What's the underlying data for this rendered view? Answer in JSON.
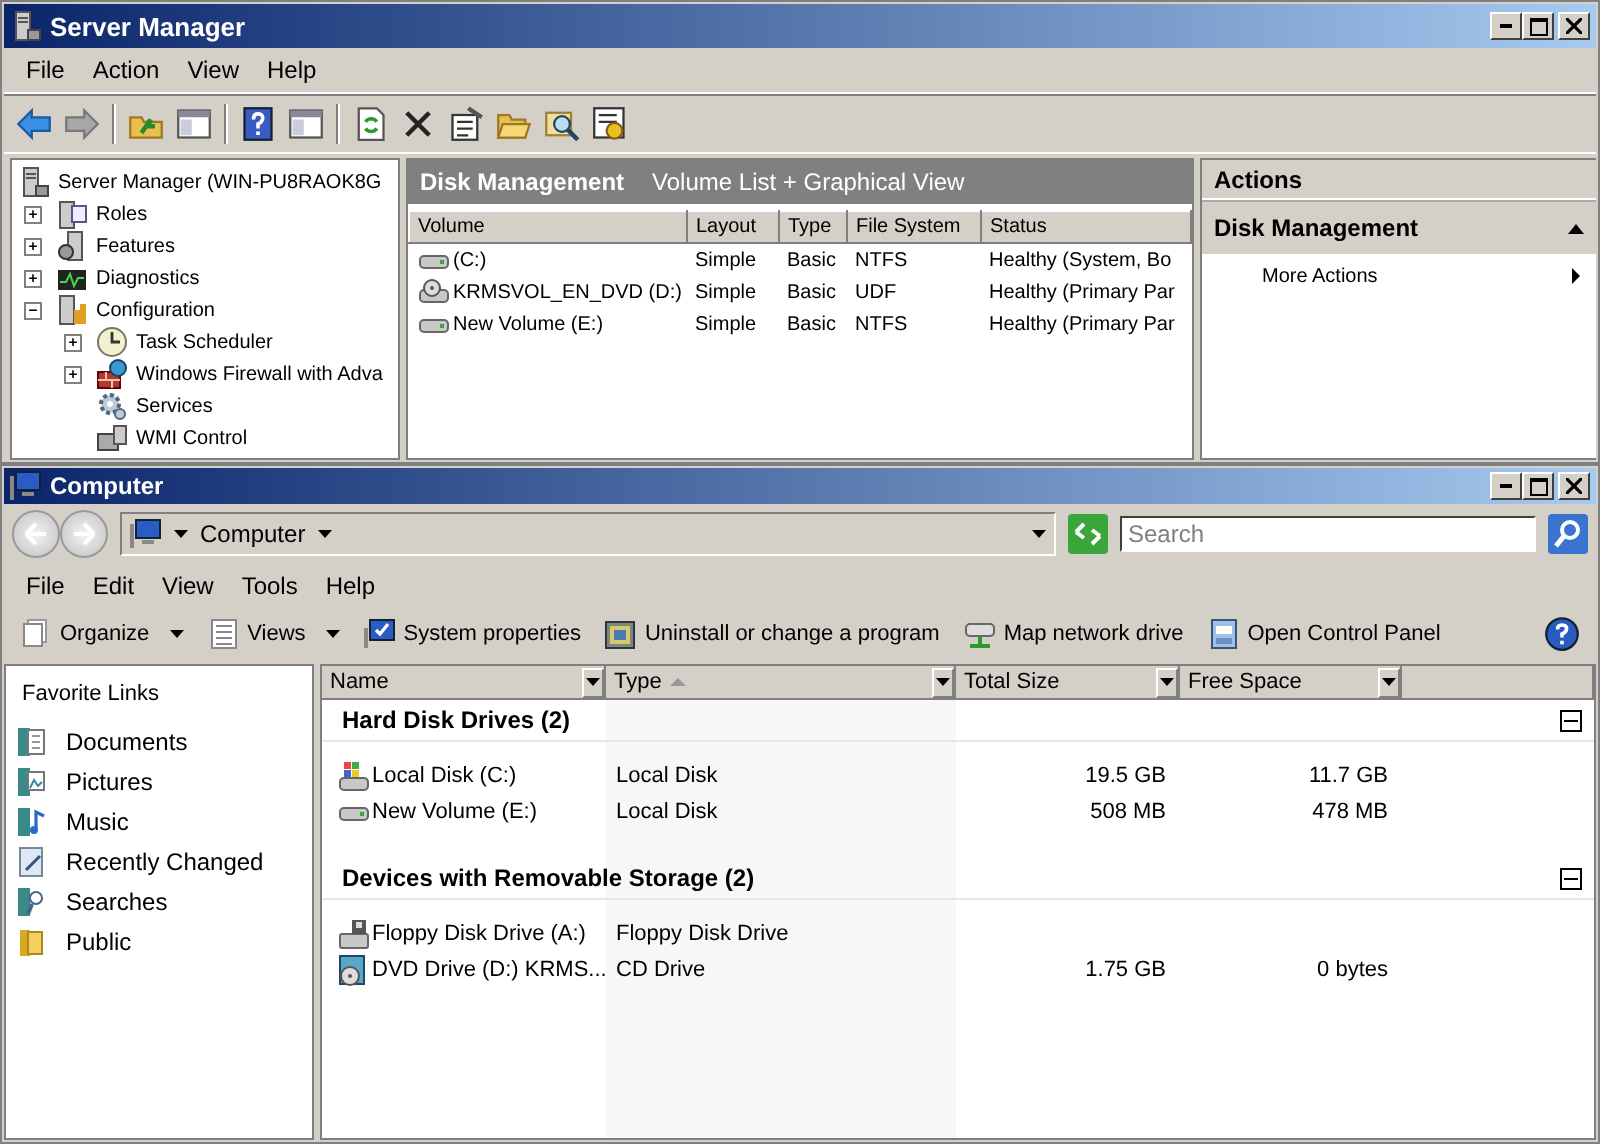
{
  "server_manager": {
    "title": "Server Manager",
    "menu": [
      "File",
      "Action",
      "View",
      "Help"
    ],
    "tree": {
      "label": "Server Manager (WIN-PU8RAOK8G",
      "children": [
        {
          "label": "Roles",
          "expanded": false
        },
        {
          "label": "Features",
          "expanded": false
        },
        {
          "label": "Diagnostics",
          "expanded": false
        },
        {
          "label": "Configuration",
          "expanded": true,
          "children": [
            {
              "label": "Task Scheduler",
              "expanded": false
            },
            {
              "label": "Windows Firewall with Adva",
              "expanded": false
            },
            {
              "label": "Services"
            },
            {
              "label": "WMI Control"
            }
          ]
        }
      ]
    },
    "center": {
      "title": "Disk Management",
      "subtitle": "Volume List + Graphical View",
      "columns": [
        "Volume",
        "Layout",
        "Type",
        "File System",
        "Status"
      ],
      "rows": [
        [
          "(C:)",
          "Simple",
          "Basic",
          "NTFS",
          "Healthy (System, Bo"
        ],
        [
          "KRMSVOL_EN_DVD (D:)",
          "Simple",
          "Basic",
          "UDF",
          "Healthy (Primary Par"
        ],
        [
          "New Volume (E:)",
          "Simple",
          "Basic",
          "NTFS",
          "Healthy (Primary Par"
        ]
      ]
    },
    "actions": {
      "title": "Actions",
      "sections": [
        {
          "title": "Disk Management",
          "expanded": true,
          "items": [
            "More Actions"
          ]
        }
      ]
    }
  },
  "computer": {
    "title": "Computer",
    "address": "Computer",
    "search": {
      "placeholder": "Search"
    },
    "menu": [
      "File",
      "Edit",
      "View",
      "Tools",
      "Help"
    ],
    "commands": [
      {
        "label": "Organize",
        "dropdown": true
      },
      {
        "label": "Views",
        "dropdown": true
      },
      {
        "label": "System properties",
        "dropdown": false
      },
      {
        "label": "Uninstall or change a program",
        "dropdown": false
      },
      {
        "label": "Map network drive",
        "dropdown": false
      },
      {
        "label": "Open Control Panel",
        "dropdown": false
      }
    ],
    "favorites": {
      "title": "Favorite Links",
      "links": [
        "Documents",
        "Pictures",
        "Music",
        "Recently Changed",
        "Searches",
        "Public"
      ]
    },
    "columns": [
      {
        "label": "Name",
        "sorted": false
      },
      {
        "label": "Type",
        "sorted": true
      },
      {
        "label": "Total Size",
        "sorted": false
      },
      {
        "label": "Free Space",
        "sorted": false
      }
    ],
    "groups": [
      {
        "title": "Hard Disk Drives (2)",
        "expanded": true,
        "items": [
          {
            "name": "Local Disk (C:)",
            "type": "Local Disk",
            "total_size": "19.5 GB",
            "free_space": "11.7 GB"
          },
          {
            "name": "New Volume (E:)",
            "type": "Local Disk",
            "total_size": "508 MB",
            "free_space": "478 MB"
          }
        ]
      },
      {
        "title": "Devices with Removable Storage (2)",
        "expanded": true,
        "items": [
          {
            "name": "Floppy Disk Drive (A:)",
            "type": "Floppy Disk Drive"
          },
          {
            "name": "DVD Drive (D:) KRMS...",
            "type": "CD Drive",
            "total_size": "1.75 GB",
            "free_space": "0 bytes"
          }
        ]
      }
    ]
  }
}
